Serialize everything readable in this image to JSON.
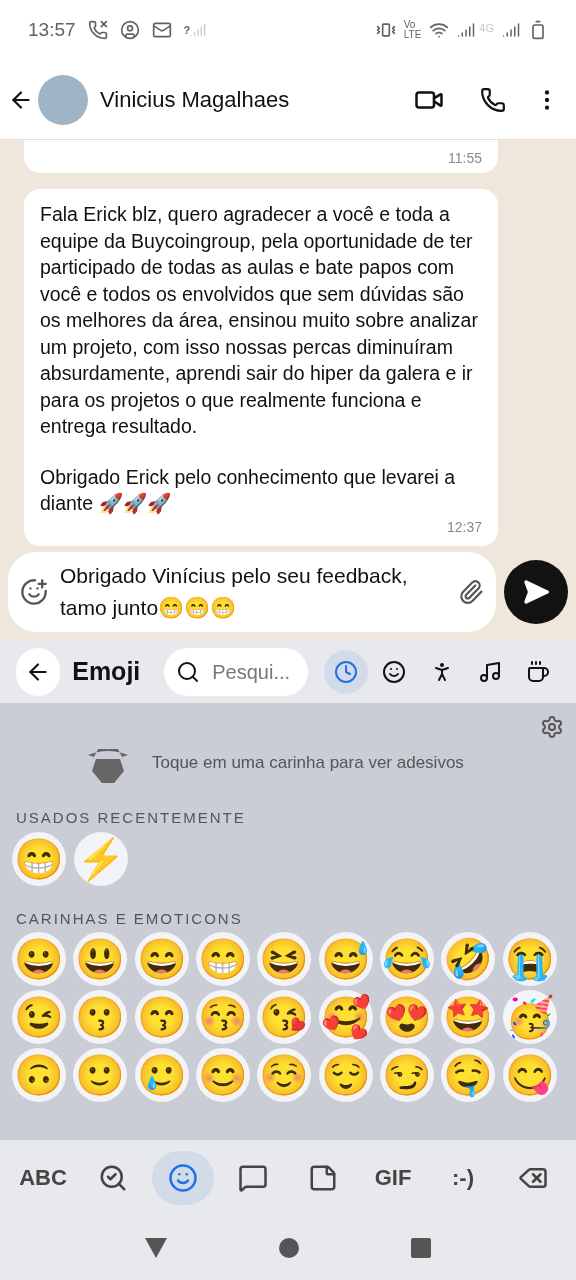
{
  "status_bar": {
    "time": "13:57",
    "network_hint": "?",
    "volte_top": "Vo",
    "volte_bottom": "LTE",
    "network_type": "4G"
  },
  "header": {
    "contact_name": "Vinicius Magalhaes"
  },
  "messages": [
    {
      "kind": "partial",
      "time": "11:55"
    },
    {
      "kind": "full",
      "paragraphs": [
        "Fala Erick blz, quero agradecer a você e toda a equipe da Buycoingroup, pela oportunidade de ter participado de todas as aulas e bate papos com você e todos os envolvidos que sem dúvidas são os melhores da área, ensinou muito sobre analizar um projeto, com isso nossas percas diminuíram absurdamente, aprendi sair do hiper da galera e ir para os projetos o que realmente funciona e entrega resultado.",
        "Obrigado Erick pelo conhecimento que levarei a diante 🚀🚀🚀"
      ],
      "time": "12:37"
    }
  ],
  "composer": {
    "value": "Obrigado Vinícius pelo seu feedback, tamo junto😁😁😁"
  },
  "emoji_bar": {
    "title": "Emoji",
    "search_placeholder": "Pesqui...",
    "categories": [
      {
        "kind": "recent",
        "selected": true
      },
      {
        "kind": "smileys",
        "selected": false
      },
      {
        "kind": "people",
        "selected": false
      },
      {
        "kind": "activities",
        "selected": false
      },
      {
        "kind": "food",
        "selected": false
      }
    ]
  },
  "emoji_panel": {
    "sticker_hint": "Toque em uma carinha para ver adesivos",
    "sections": [
      {
        "title": "USADOS RECENTEMENTE",
        "rows": [
          [
            "😁",
            "⚡"
          ]
        ]
      },
      {
        "title": "CARINHAS E EMOTICONS",
        "rows": [
          [
            "😀",
            "😃",
            "😄",
            "😁",
            "😆",
            "😅",
            "😂",
            "🤣",
            "😭"
          ],
          [
            "😉",
            "😗",
            "😙",
            "😚",
            "😘",
            "🥰",
            "😍",
            "🤩",
            "🥳"
          ],
          [
            "🙃",
            "🙂",
            "🥲",
            "😊",
            "☺️",
            "😌",
            "😏",
            "🤤",
            "😋"
          ]
        ]
      }
    ]
  },
  "keyboard_bar": [
    {
      "kind": "text",
      "label": "ABC",
      "selected": false
    },
    {
      "kind": "sticker-search",
      "selected": false
    },
    {
      "kind": "emoji",
      "selected": true
    },
    {
      "kind": "bitmoji",
      "selected": false
    },
    {
      "kind": "sticker",
      "selected": false
    },
    {
      "kind": "text",
      "label": "GIF",
      "selected": false
    },
    {
      "kind": "text",
      "label": ":-)",
      "selected": false
    },
    {
      "kind": "backspace",
      "selected": false
    }
  ]
}
